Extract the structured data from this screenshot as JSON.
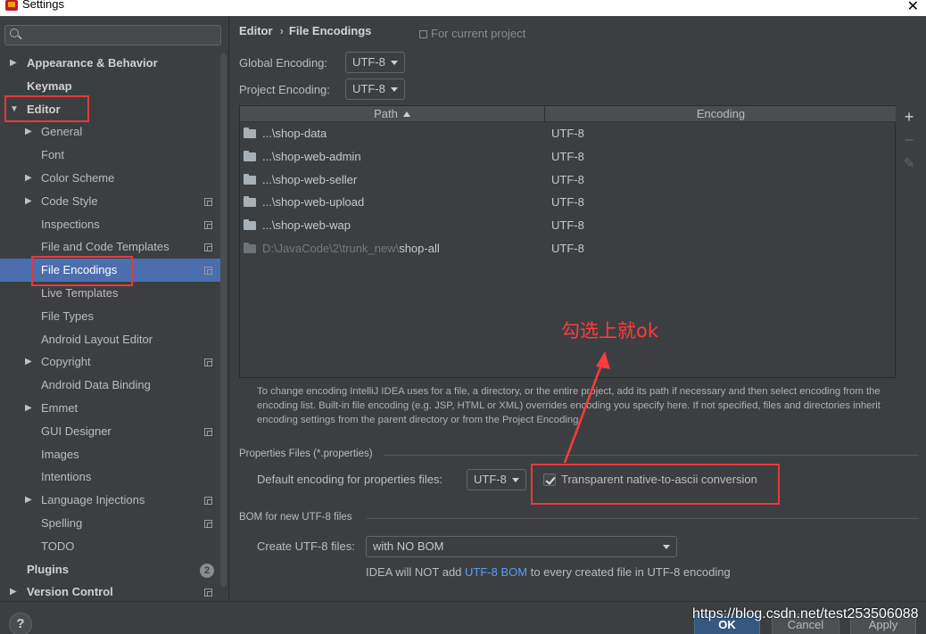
{
  "window": {
    "title": "Settings",
    "close_glyph": "✕"
  },
  "search": {
    "placeholder": "",
    "value": ""
  },
  "breadcrumb": {
    "parent": "Editor",
    "separator": "›",
    "current": "File Encodings"
  },
  "for_current_project": "For current project",
  "global_encoding": {
    "label": "Global Encoding:",
    "value": "UTF-8"
  },
  "project_encoding": {
    "label": "Project Encoding:",
    "value": "UTF-8"
  },
  "table": {
    "columns": {
      "path": "Path",
      "encoding": "Encoding"
    },
    "rows": [
      {
        "path_prefix": "",
        "path": "...\\shop-data",
        "encoding": "UTF-8"
      },
      {
        "path_prefix": "",
        "path": "...\\shop-web-admin",
        "encoding": "UTF-8"
      },
      {
        "path_prefix": "",
        "path": "...\\shop-web-seller",
        "encoding": "UTF-8"
      },
      {
        "path_prefix": "",
        "path": "...\\shop-web-upload",
        "encoding": "UTF-8"
      },
      {
        "path_prefix": "",
        "path": "...\\shop-web-wap",
        "encoding": "UTF-8"
      },
      {
        "path_prefix": "D:\\JavaCode\\2\\trunk_new\\",
        "path": "shop-all",
        "encoding": "UTF-8"
      }
    ],
    "tools": {
      "add": "+",
      "remove": "−",
      "edit": "✎"
    }
  },
  "help_text": "To change encoding IntelliJ IDEA uses for a file, a directory, or the entire project, add its path if necessary and then select encoding from the encoding list. Built-in file encoding (e.g. JSP, HTML or XML) overrides encoding you specify here. If not specified, files and directories inherit encoding settings from the parent directory or from the Project Encoding.",
  "properties_section": {
    "title": "Properties Files (*.properties)",
    "default_label": "Default encoding for properties files:",
    "default_value": "UTF-8",
    "transparent_label": "Transparent native-to-ascii conversion",
    "transparent_checked": true
  },
  "bom_section": {
    "title": "BOM for new UTF-8 files",
    "create_label": "Create UTF-8 files:",
    "create_value": "with NO BOM",
    "note_before": "IDEA will NOT add ",
    "note_link": "UTF-8 BOM",
    "note_after": " to every created file in UTF-8 encoding"
  },
  "annotation": {
    "text": "勾选上就ok",
    "color": "#ff3b3b"
  },
  "sidebar": {
    "items": [
      {
        "label": "Appearance & Behavior",
        "arrow": "▶"
      },
      {
        "label": "Keymap"
      },
      {
        "label": "Editor",
        "arrow": "▼"
      },
      {
        "label": "General",
        "arrow": "▶"
      },
      {
        "label": "Font"
      },
      {
        "label": "Color Scheme",
        "arrow": "▶"
      },
      {
        "label": "Code Style",
        "arrow": "▶"
      },
      {
        "label": "Inspections"
      },
      {
        "label": "File and Code Templates"
      },
      {
        "label": "File Encodings"
      },
      {
        "label": "Live Templates"
      },
      {
        "label": "File Types"
      },
      {
        "label": "Android Layout Editor"
      },
      {
        "label": "Copyright",
        "arrow": "▶"
      },
      {
        "label": "Android Data Binding"
      },
      {
        "label": "Emmet",
        "arrow": "▶"
      },
      {
        "label": "GUI Designer"
      },
      {
        "label": "Images"
      },
      {
        "label": "Intentions"
      },
      {
        "label": "Language Injections",
        "arrow": "▶"
      },
      {
        "label": "Spelling"
      },
      {
        "label": "TODO"
      },
      {
        "label": "Plugins",
        "badge": "2"
      },
      {
        "label": "Version Control",
        "arrow": "▶"
      }
    ]
  },
  "footer": {
    "help": "?",
    "ok": "OK",
    "cancel": "Cancel",
    "apply": "Apply",
    "watermark": "https://blog.csdn.net/test253506088"
  },
  "colors": {
    "selection": "#4b6eaf",
    "link": "#589df6",
    "highlight_box": "#e8383d"
  }
}
